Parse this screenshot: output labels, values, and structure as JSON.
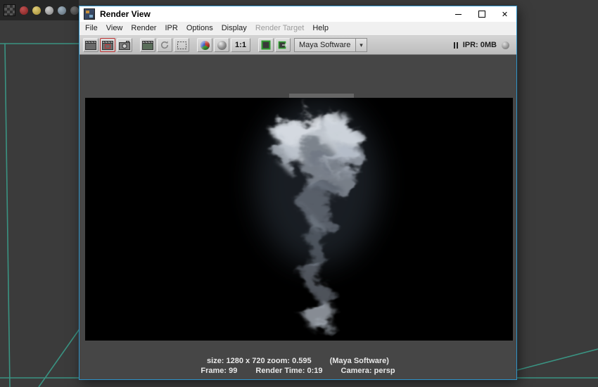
{
  "window": {
    "title": "Render View",
    "close_glyph": "✕"
  },
  "menu": {
    "items": [
      {
        "label": "File"
      },
      {
        "label": "View"
      },
      {
        "label": "Render"
      },
      {
        "label": "IPR"
      },
      {
        "label": "Options"
      },
      {
        "label": "Display"
      },
      {
        "label": "Render Target"
      },
      {
        "label": "Help"
      }
    ]
  },
  "toolbar": {
    "one_to_one": "1:1",
    "renderer": "Maya Software",
    "dropdown_arrow": "▾",
    "ipr_memory": "IPR: 0MB"
  },
  "status": {
    "size_zoom": "size: 1280 x 720 zoom: 0.595",
    "renderer_note": "(Maya Software)",
    "frame": "Frame: 99",
    "render_time": "Render Time: 0:19",
    "camera": "Camera: persp"
  },
  "colors": {
    "window_border": "#2e93c9",
    "grid_line": "#3aa38f",
    "region_highlight": "#c03030",
    "settings_green": "#2f9e2f"
  }
}
